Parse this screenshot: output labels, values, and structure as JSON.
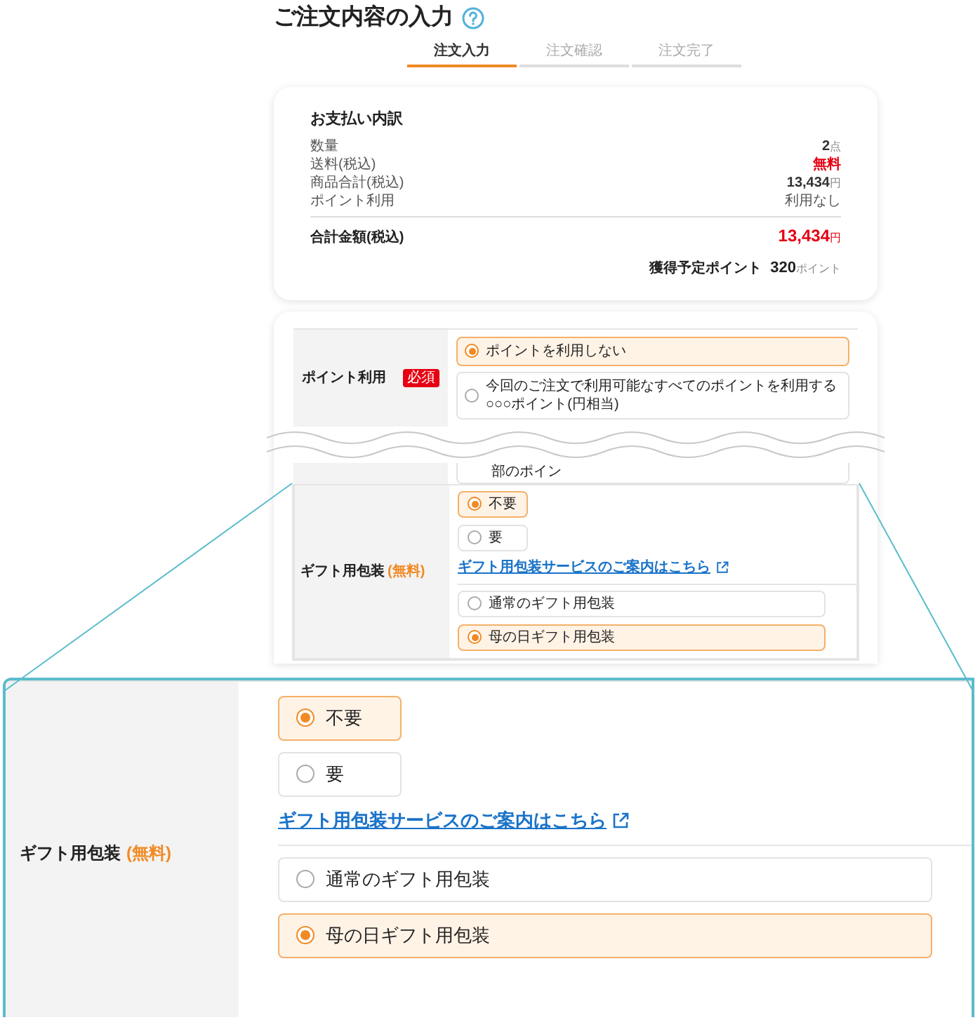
{
  "page_title": "ご注文内容の入力",
  "steps": [
    {
      "label": "注文入力",
      "selected": true
    },
    {
      "label": "注文確認",
      "selected": false
    },
    {
      "label": "注文完了",
      "selected": false
    }
  ],
  "payment_summary": {
    "title": "お支払い内訳",
    "rows": [
      {
        "label": "数量",
        "value": "2",
        "unit": "点",
        "kind": "number"
      },
      {
        "label": "送料(税込)",
        "value": "無料",
        "kind": "free"
      },
      {
        "label": "商品合計(税込)",
        "value": "13,434",
        "unit": "円",
        "kind": "number"
      },
      {
        "label": "ポイント利用",
        "value": "利用なし",
        "kind": "text"
      }
    ],
    "total": {
      "label": "合計金額(税込)",
      "value": "13,434",
      "unit": "円"
    },
    "points": {
      "label": "獲得予定ポイント",
      "value": "320",
      "unit": "ポイント"
    }
  },
  "point_usage": {
    "label": "ポイント利用",
    "badge": "必須",
    "options": [
      {
        "lines": [
          "ポイントを利用しない"
        ],
        "selected": true
      },
      {
        "lines": [
          "今回のご注文で利用可能なすべてのポイントを利用する",
          "○○○ポイント(円相当)"
        ],
        "selected": false
      }
    ],
    "cut_option": "部のポイン"
  },
  "gift_wrapping": {
    "label": "ギフト用包装",
    "note": "(無料)",
    "need_options": [
      {
        "label": "不要",
        "selected": true
      },
      {
        "label": "要",
        "selected": false
      }
    ],
    "link": "ギフト用包装サービスのご案内はこちら",
    "type_options": [
      {
        "label": "通常のギフト用包装",
        "selected": false
      },
      {
        "label": "母の日ギフト用包装",
        "selected": true
      }
    ]
  },
  "gift_wrapping_zoomed": {
    "label": "ギフト用包装",
    "note": "(無料)",
    "need_options": [
      {
        "label": "不要",
        "selected": true
      },
      {
        "label": "要",
        "selected": false
      }
    ],
    "link": "ギフト用包装サービスのご案内はこちら",
    "type_options": [
      {
        "label": "通常のギフト用包装",
        "selected": false
      },
      {
        "label": "母の日ギフト用包装",
        "selected": true
      }
    ]
  }
}
